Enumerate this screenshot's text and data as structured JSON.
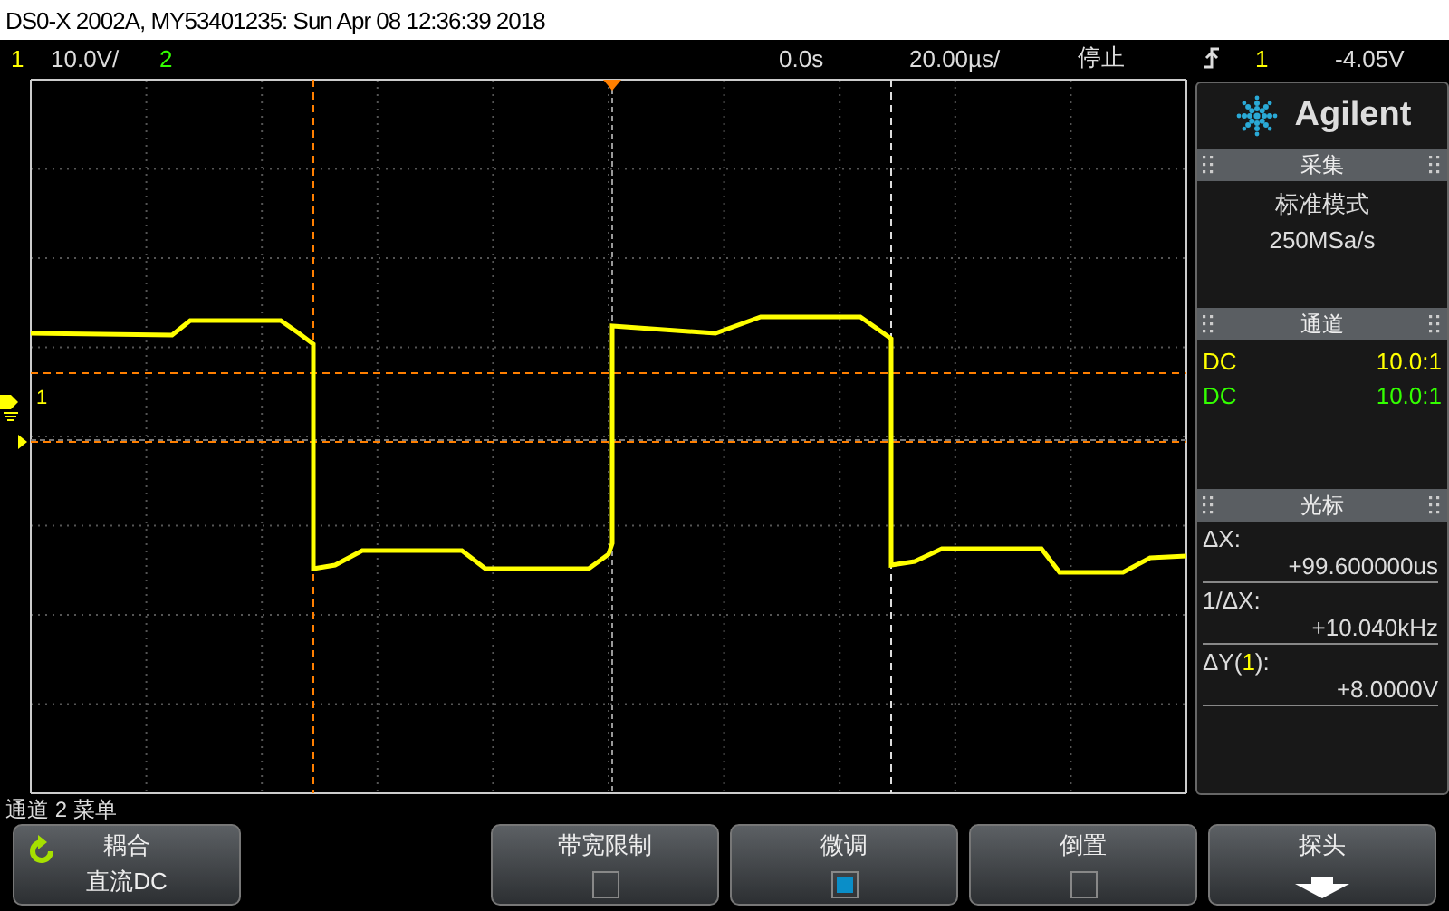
{
  "window": {
    "title": "DS0-X 2002A, MY53401235: Sun Apr 08 12:36:39 2018"
  },
  "status_bar": {
    "ch1": {
      "label": "1",
      "color": "#ffff00"
    },
    "scale": "10.0V/",
    "ch2": {
      "label": "2",
      "color": "#33ff00"
    },
    "delay": "0.0s",
    "timebase": "20.00µs/",
    "run_state": "停止",
    "trigger_source": {
      "label": "1",
      "color": "#ffff00"
    },
    "trigger_level": "-4.05V"
  },
  "plot": {
    "channel_marker": {
      "label": "1",
      "color": "#ffff00"
    }
  },
  "panel": {
    "brand": "Agilent",
    "acquisition": {
      "header": "采集",
      "mode": "标准模式",
      "rate": "250MSa/s"
    },
    "channels_header": "通道",
    "channels": [
      {
        "coupling": "DC",
        "probe": "10.0:1",
        "color": "#ffff00"
      },
      {
        "coupling": "DC",
        "probe": "10.0:1",
        "color": "#33ff00"
      }
    ],
    "cursors": {
      "header": "光标",
      "items": [
        {
          "label": [
            {
              "text": "ΔX:"
            }
          ],
          "value": "+99.600000us"
        },
        {
          "label": [
            {
              "text": "1/ΔX:"
            }
          ],
          "value": "+10.040kHz"
        },
        {
          "label": [
            {
              "text": "ΔY("
            },
            {
              "text": "1",
              "color": "#ffff00"
            },
            {
              "text": "):"
            }
          ],
          "value": "+8.0000V"
        }
      ]
    }
  },
  "menu_title": "通道 2 菜单",
  "softkeys": [
    {
      "kind": "cycle",
      "label": "耦合",
      "value": "直流DC"
    },
    {
      "kind": "toggle",
      "label": "带宽限制",
      "checked": false
    },
    {
      "kind": "toggle",
      "label": "微调",
      "checked": true
    },
    {
      "kind": "toggle",
      "label": "倒置",
      "checked": false
    },
    {
      "kind": "submenu",
      "label": "探头"
    }
  ]
}
